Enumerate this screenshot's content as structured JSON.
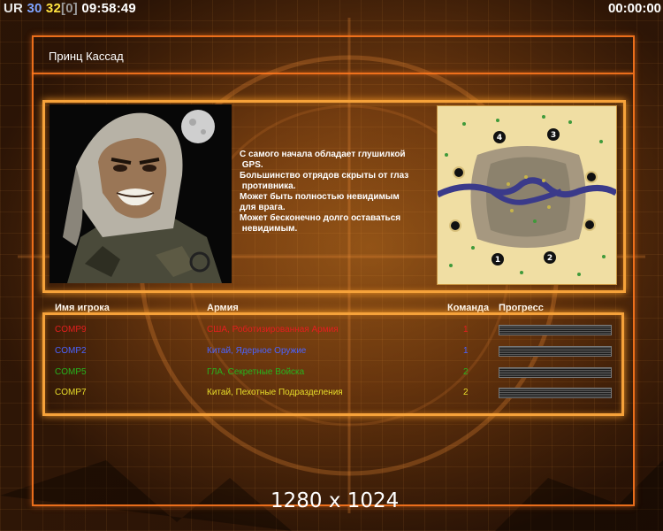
{
  "hud": {
    "faction": "UR",
    "value_a": "30",
    "value_b": "32",
    "value_c": "[0]",
    "clock": "09:58:49",
    "timer": "00:00:00"
  },
  "title": "Принц Кассад",
  "description": [
    "С самого начала обладает глушилкой",
    " GPS.",
    "Большинство отрядов скрыты от глаз",
    " противника.",
    "Может быть полностью невидимым",
    "для врага.",
    "Может бесконечно долго оставаться",
    " невидимым."
  ],
  "map": {
    "start_positions": [
      "1",
      "2",
      "3",
      "4"
    ]
  },
  "table": {
    "headers": {
      "player": "Имя игрока",
      "army": "Армия",
      "team": "Команда",
      "progress": "Прогресс"
    },
    "rows": [
      {
        "player": "COMP9",
        "army": "США, Роботизированная Армия",
        "team": "1",
        "color": "#e51e1e",
        "progress": 1.0
      },
      {
        "player": "COMP2",
        "army": "Китай, Ядерное Оружие",
        "team": "1",
        "color": "#4a63ff",
        "progress": 1.0
      },
      {
        "player": "COMP5",
        "army": "ГЛА, Секретные Войска",
        "team": "2",
        "color": "#26b51e",
        "progress": 1.0
      },
      {
        "player": "COMP7",
        "army": "Китай, Пехотные Подразделения",
        "team": "2",
        "color": "#e8dd2a",
        "progress": 1.0
      }
    ]
  },
  "resolution": "1280 x 1024",
  "colors": {
    "frame": "#f6a23a",
    "accent": "#ff781e"
  }
}
